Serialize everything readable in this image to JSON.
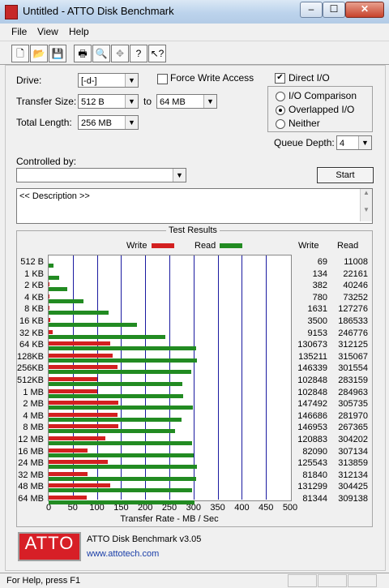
{
  "window": {
    "title": "Untitled - ATTO Disk Benchmark",
    "min": "–",
    "max": "☐",
    "close": "✕"
  },
  "menu": [
    "File",
    "View",
    "Help"
  ],
  "toolbar": [
    {
      "icon": "new-icon",
      "glyph": "🗋"
    },
    {
      "icon": "open-icon",
      "glyph": "📂"
    },
    {
      "icon": "save-icon",
      "glyph": "💾"
    },
    {
      "icon": "print-icon",
      "glyph": "🖶"
    },
    {
      "icon": "print-preview-icon",
      "glyph": "🔍"
    },
    {
      "icon": "move-icon",
      "glyph": "✥"
    },
    {
      "icon": "help-icon",
      "glyph": "?"
    },
    {
      "icon": "context-help-icon",
      "glyph": "↖?"
    }
  ],
  "settings": {
    "drive_label": "Drive:",
    "drive_value": "[-d-]",
    "transfer_label": "Transfer Size:",
    "transfer_from": "512 B",
    "to_label": "to",
    "transfer_to": "64 MB",
    "total_label": "Total Length:",
    "total_value": "256 MB",
    "force_write_label": "Force Write Access",
    "force_write_checked": false,
    "direct_io_label": "Direct I/O",
    "direct_io_checked": true,
    "io_comparison": "I/O Comparison",
    "overlapped_io": "Overlapped I/O",
    "neither": "Neither",
    "queue_label": "Queue Depth:",
    "queue_value": "4",
    "controlled_label": "Controlled by:",
    "controlled_value": "",
    "start_label": "Start",
    "description": "<< Description >>"
  },
  "results": {
    "legend": "Test Results",
    "write_label": "Write",
    "read_label": "Read",
    "col_write": "Write",
    "col_read": "Read",
    "xlabel": "Transfer Rate - MB / Sec",
    "colors": {
      "write": "#d32020",
      "read": "#228b22"
    }
  },
  "chart_data": {
    "type": "bar",
    "orientation": "horizontal",
    "xlabel": "Transfer Rate - MB / Sec",
    "xlim": [
      0,
      500
    ],
    "xticks": [
      0,
      50,
      100,
      150,
      200,
      250,
      300,
      350,
      400,
      450,
      500
    ],
    "categories": [
      "512 B",
      "1 KB",
      "2 KB",
      "4 KB",
      "8 KB",
      "16 KB",
      "32 KB",
      "64 KB",
      "128KB",
      "256KB",
      "512KB",
      "1 MB",
      "2 MB",
      "4 MB",
      "8 MB",
      "12 MB",
      "16 MB",
      "24 MB",
      "32 MB",
      "48 MB",
      "64 MB"
    ],
    "series": [
      {
        "name": "Write",
        "values": [
          69,
          134,
          382,
          780,
          1631,
          3500,
          9153,
          130673,
          135211,
          146339,
          102848,
          102848,
          147492,
          146686,
          146953,
          120883,
          82090,
          125543,
          81840,
          131299,
          81344
        ]
      },
      {
        "name": "Read",
        "values": [
          11008,
          22161,
          40246,
          73252,
          127276,
          186533,
          246776,
          312125,
          315067,
          301554,
          283159,
          284963,
          305735,
          281970,
          267365,
          304202,
          307134,
          313859,
          312134,
          304425,
          309138
        ]
      }
    ],
    "units": "KB/s"
  },
  "footer": {
    "logo": "ATTO",
    "product": "ATTO Disk Benchmark v3.05",
    "url": "www.attotech.com"
  },
  "status": {
    "text": "For Help, press F1"
  }
}
